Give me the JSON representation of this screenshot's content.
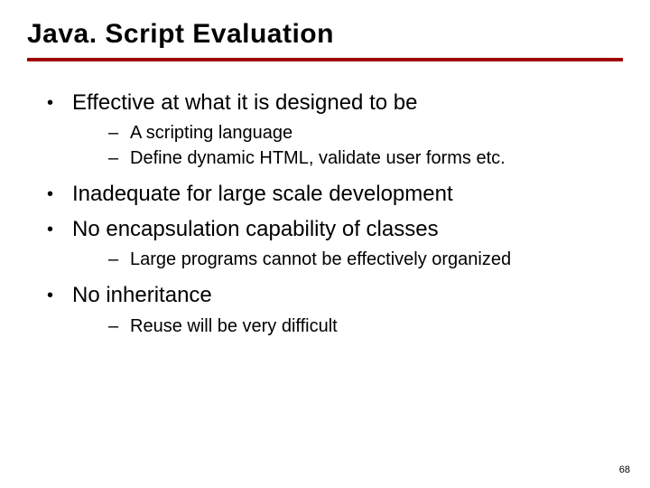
{
  "title": "Java. Script Evaluation",
  "bullets": [
    {
      "text": "Effective at what it is designed to be",
      "subs": [
        "A scripting language",
        "Define dynamic HTML, validate user forms etc."
      ]
    },
    {
      "text": "Inadequate for large scale development",
      "subs": []
    },
    {
      "text": "No encapsulation capability of classes",
      "subs": [
        "Large programs cannot be effectively organized"
      ]
    },
    {
      "text": "No inheritance",
      "subs": [
        "Reuse will be very difficult"
      ]
    }
  ],
  "page_number": "68",
  "accent_color": "#a00000"
}
